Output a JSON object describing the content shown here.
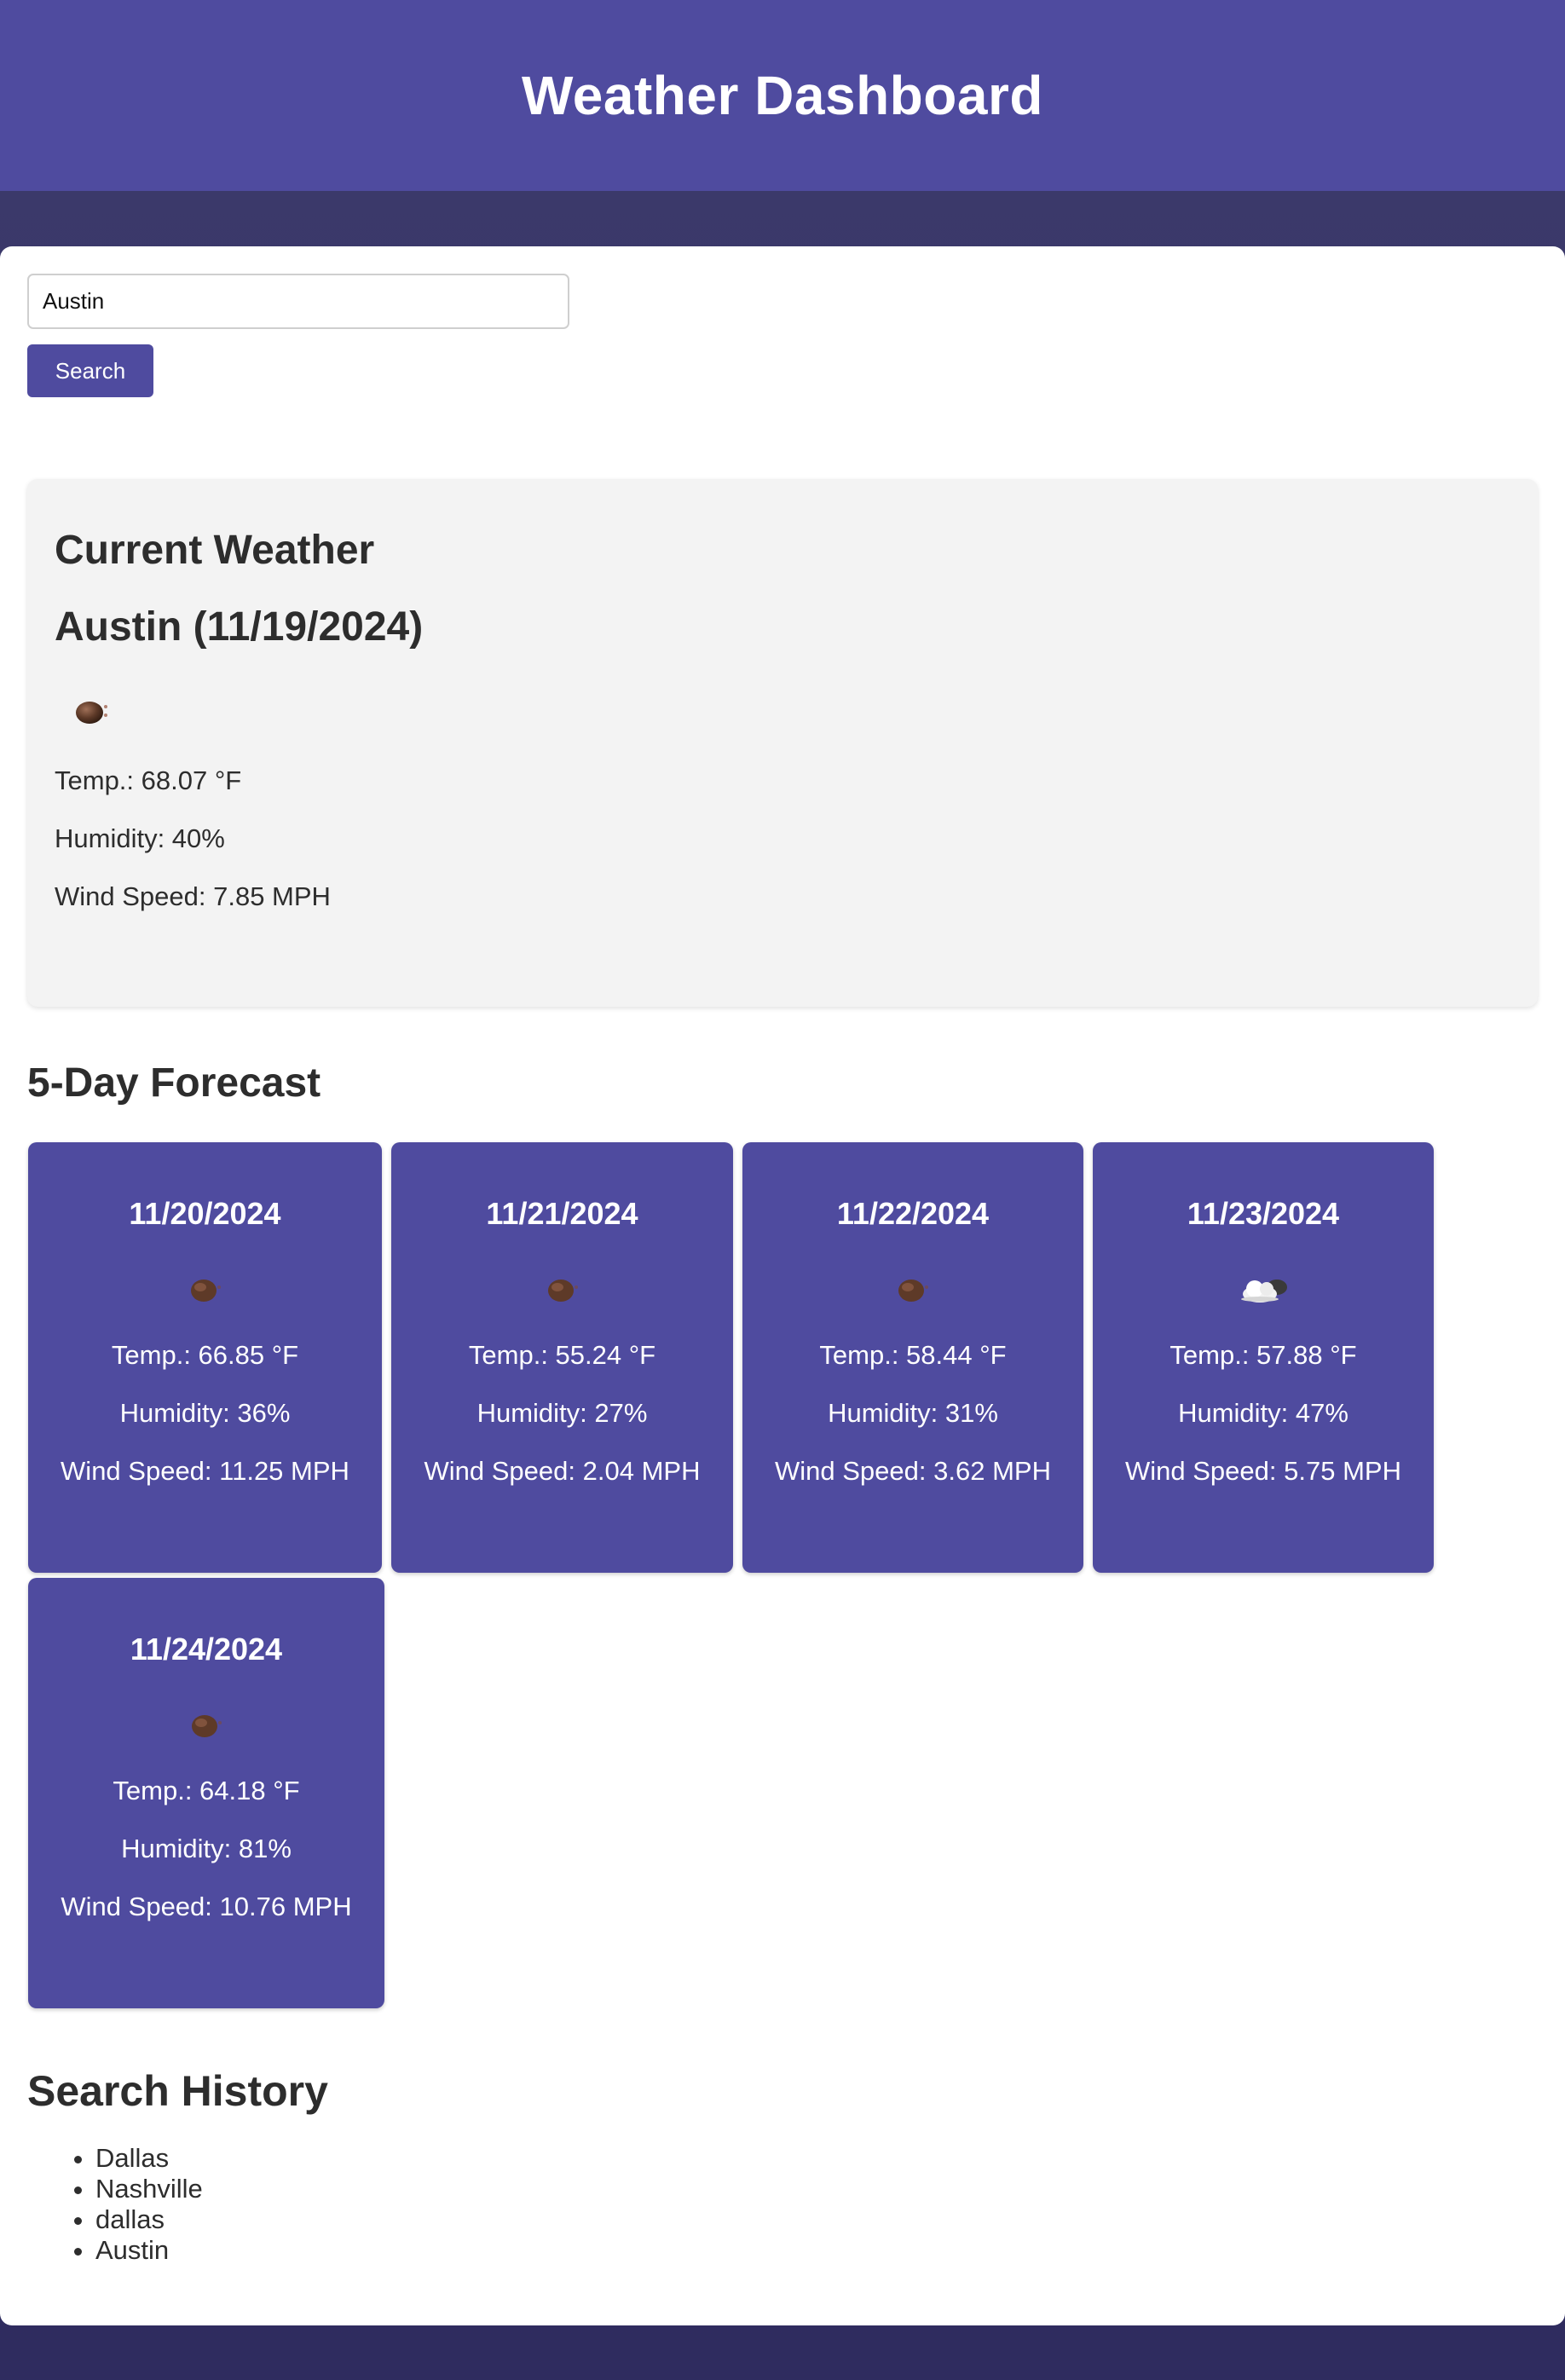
{
  "header": {
    "title": "Weather Dashboard"
  },
  "search": {
    "value": "Austin",
    "button_label": "Search"
  },
  "current": {
    "section_title": "Current Weather",
    "city_date": "Austin (11/19/2024)",
    "icon": "clear-night-icon",
    "temp": "Temp.: 68.07 °F",
    "humidity": "Humidity: 40%",
    "wind": "Wind Speed: 7.85 MPH"
  },
  "forecast": {
    "title": "5-Day Forecast",
    "days": [
      {
        "date": "11/20/2024",
        "icon": "clear-night-icon",
        "temp": "Temp.: 66.85 °F",
        "humidity": "Humidity: 36%",
        "wind": "Wind Speed: 11.25 MPH"
      },
      {
        "date": "11/21/2024",
        "icon": "clear-night-icon",
        "temp": "Temp.: 55.24 °F",
        "humidity": "Humidity: 27%",
        "wind": "Wind Speed: 2.04 MPH"
      },
      {
        "date": "11/22/2024",
        "icon": "clear-night-icon",
        "temp": "Temp.: 58.44 °F",
        "humidity": "Humidity: 31%",
        "wind": "Wind Speed: 3.62 MPH"
      },
      {
        "date": "11/23/2024",
        "icon": "cloudy-night-icon",
        "temp": "Temp.: 57.88 °F",
        "humidity": "Humidity: 47%",
        "wind": "Wind Speed: 5.75 MPH"
      },
      {
        "date": "11/24/2024",
        "icon": "clear-night-icon",
        "temp": "Temp.: 64.18 °F",
        "humidity": "Humidity: 81%",
        "wind": "Wind Speed: 10.76 MPH"
      }
    ]
  },
  "history": {
    "title": "Search History",
    "items": [
      "Dallas",
      "Nashville",
      "dallas",
      "Austin"
    ]
  },
  "colors": {
    "accent": "#4f4b9f",
    "background": "#2f2c5f",
    "card": "#f3f3f3"
  }
}
